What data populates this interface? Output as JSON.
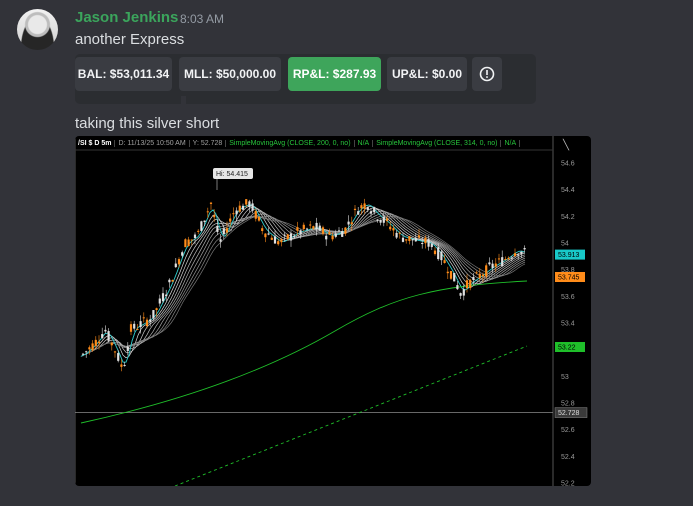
{
  "message": {
    "author": "Jason Jenkins",
    "time": "8:03 AM",
    "text1": "another Express",
    "text2": "taking this silver short"
  },
  "buttons": {
    "bal": "BAL: $53,011.34",
    "mll": "MLL: $50,000.00",
    "rpl": "RP&L: $287.93",
    "upl": "UP&L: $0.00",
    "info_icon": "alert-circle-icon"
  },
  "chart": {
    "symbol": "/SI $ D 5m",
    "datetime": "D: 11/13/25 10:50 AM",
    "y_readout": "Y: 52.728",
    "study1": "SimpleMovingAvg (CLOSE, 200, 0, no)",
    "study1_val": "N/A",
    "study2": "SimpleMovingAvg (CLOSE, 314, 0, no)",
    "study2_val": "N/A",
    "hi_label": "Hi: 54.415",
    "crosshair_price": "52.728",
    "price_labels": [
      "54.6",
      "54.4",
      "54.2",
      "54",
      "53.8",
      "53.6",
      "53.4",
      "53.2",
      "53",
      "52.8",
      "52.6",
      "52.4",
      "52.2"
    ],
    "marker_cyan": "53.913",
    "marker_orange": "53.745",
    "marker_green": "53.22",
    "colors": {
      "up": "#e0e0e0",
      "down": "#ff8c1a",
      "sma200": "#1fbf2a",
      "sma314": "#1fbf2a",
      "cyan": "#18c8c8"
    }
  }
}
